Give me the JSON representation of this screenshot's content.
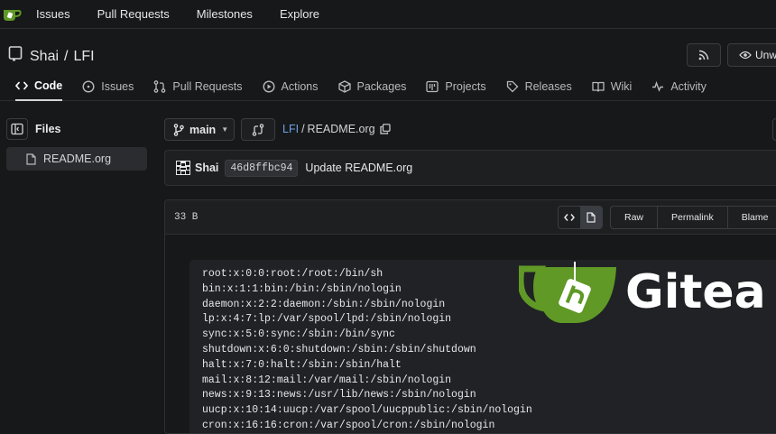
{
  "topnav": {
    "items": [
      "Issues",
      "Pull Requests",
      "Milestones",
      "Explore"
    ]
  },
  "repo": {
    "owner": "Shai",
    "separator": "/",
    "name": "LFI",
    "unwatch_label": "Unwa"
  },
  "tabs": [
    {
      "label": "Code",
      "icon": "code-icon",
      "active": true
    },
    {
      "label": "Issues",
      "icon": "issue-icon"
    },
    {
      "label": "Pull Requests",
      "icon": "pull-request-icon"
    },
    {
      "label": "Actions",
      "icon": "play-icon"
    },
    {
      "label": "Packages",
      "icon": "package-icon"
    },
    {
      "label": "Projects",
      "icon": "project-icon"
    },
    {
      "label": "Releases",
      "icon": "tag-icon"
    },
    {
      "label": "Wiki",
      "icon": "book-icon"
    },
    {
      "label": "Activity",
      "icon": "pulse-icon"
    }
  ],
  "sidebar": {
    "title": "Files",
    "files": [
      "README.org"
    ]
  },
  "toolbar": {
    "branch": "main",
    "breadcrumb_link": "LFI",
    "breadcrumb_sep": "/",
    "breadcrumb_file": "README.org"
  },
  "commit": {
    "author": "Shai",
    "sha": "46d8ffbc94",
    "message": "Update README.org"
  },
  "file": {
    "size": "33 B",
    "actions": [
      "Raw",
      "Permalink",
      "Blame"
    ],
    "lines": [
      "root:x:0:0:root:/root:/bin/sh",
      "bin:x:1:1:bin:/bin:/sbin/nologin",
      "daemon:x:2:2:daemon:/sbin:/sbin/nologin",
      "lp:x:4:7:lp:/var/spool/lpd:/sbin/nologin",
      "sync:x:5:0:sync:/sbin:/bin/sync",
      "shutdown:x:6:0:shutdown:/sbin:/sbin/shutdown",
      "halt:x:7:0:halt:/sbin:/sbin/halt",
      "mail:x:8:12:mail:/var/mail:/sbin/nologin",
      "news:x:9:13:news:/usr/lib/news:/sbin/nologin",
      "uucp:x:10:14:uucp:/var/spool/uucppublic:/sbin/nologin",
      "cron:x:16:16:cron:/var/spool/cron:/sbin/nologin"
    ]
  },
  "brand": {
    "wordmark": "Gitea",
    "color": "#609926"
  },
  "colors": {
    "background": "#171819",
    "link": "#6ea2e6"
  }
}
